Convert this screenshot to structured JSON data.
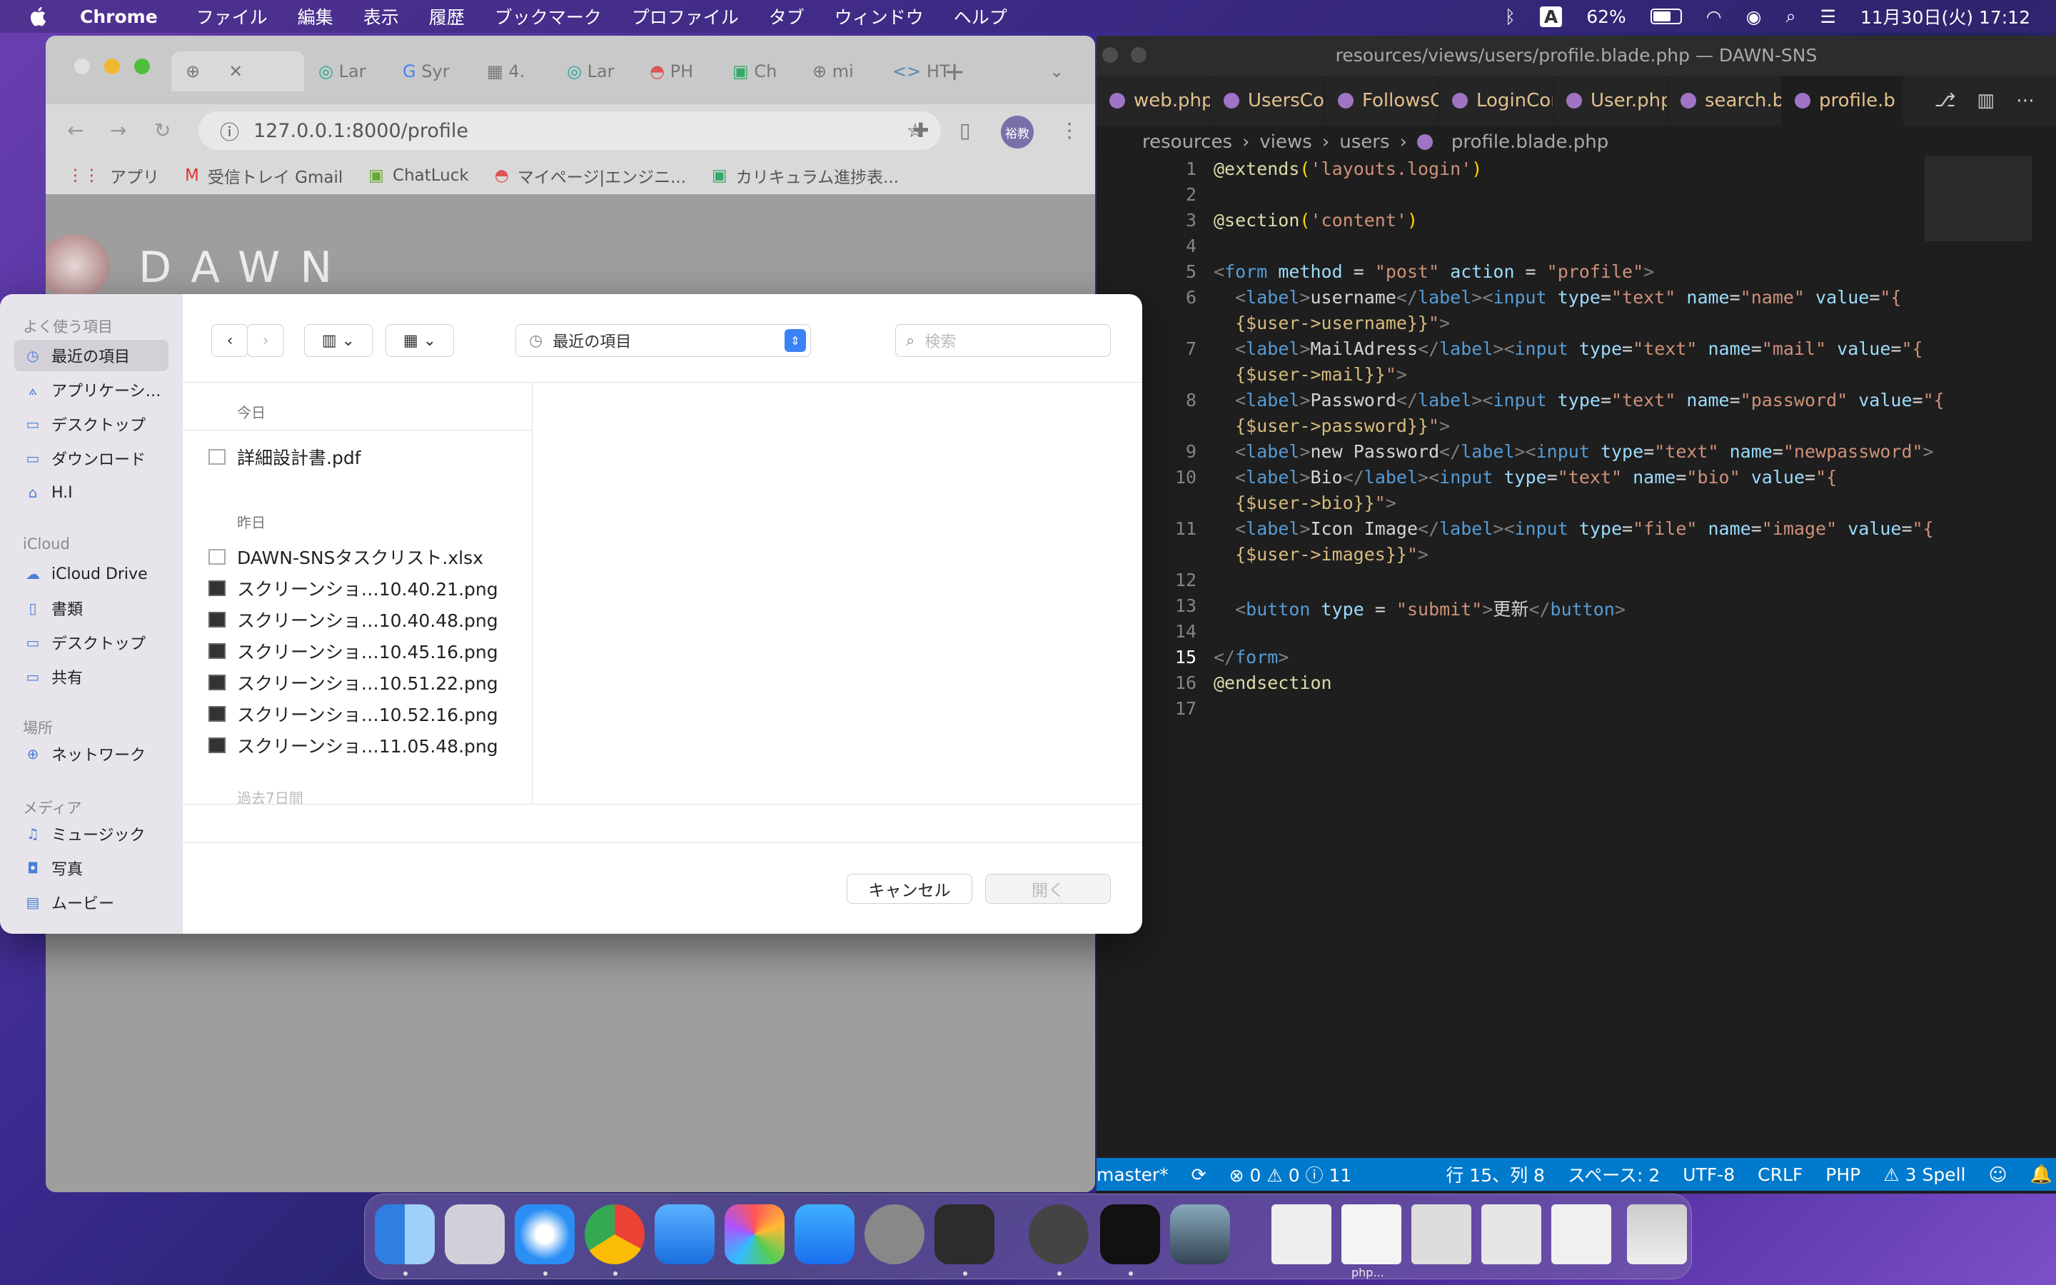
{
  "menubar": {
    "app": "Chrome",
    "items": [
      "ファイル",
      "編集",
      "表示",
      "履歴",
      "ブックマーク",
      "プロファイル",
      "タブ",
      "ウィンドウ",
      "ヘルプ"
    ],
    "input_indicator": "A",
    "battery": "62%",
    "datetime": "11月30日(火)  17:12"
  },
  "vscode": {
    "title": "resources/views/users/profile.blade.php — DAWN-SNS",
    "tabs": [
      "web.php",
      "UsersCo",
      "FollowsC",
      "LoginCon",
      "User.php",
      "search.b",
      "profile.b"
    ],
    "breadcrumb": [
      "resources",
      "views",
      "users",
      "profile.blade.php"
    ],
    "status": {
      "branch": "master*",
      "problems": "⊗ 0 ⚠ 0 ⓘ 11",
      "position": "行 15、列 8",
      "spaces": "スペース: 2",
      "encoding": "UTF-8",
      "eol": "CRLF",
      "language": "PHP",
      "spell": "⚠ 3 Spell"
    },
    "lines": [
      "1",
      "2",
      "3",
      "4",
      "5",
      "6",
      "",
      "7",
      "",
      "8",
      "",
      "9",
      "10",
      "",
      "11",
      "",
      "12",
      "13",
      "14",
      "15",
      "16",
      "17"
    ]
  },
  "chrome": {
    "url": "127.0.0.1:8000/profile",
    "tabs": [
      "Lar",
      "Syr",
      "4.",
      "Lar",
      "PH",
      "Ch",
      "mi",
      "HT"
    ],
    "avatar": "裕教",
    "bookmarks": [
      "アプリ",
      "受信トレイ Gmail",
      "ChatLuck",
      "マイページ|エンジニ...",
      "カリキュラム進捗表..."
    ],
    "page_logo": "DAWN"
  },
  "dialog": {
    "location": "最近の項目",
    "search_placeholder": "検索",
    "sidebar": {
      "favorites_header": "よく使う項目",
      "favorites": [
        "最近の項目",
        "アプリケーシ…",
        "デスクトップ",
        "ダウンロード",
        "H.I"
      ],
      "icloud_header": "iCloud",
      "icloud": [
        "iCloud Drive",
        "書類",
        "デスクトップ",
        "共有"
      ],
      "places_header": "場所",
      "places": [
        "ネットワーク"
      ],
      "media_header": "メディア",
      "media": [
        "ミュージック",
        "写真",
        "ムービー"
      ]
    },
    "groups": {
      "today": "今日",
      "yesterday": "昨日",
      "older": "過去7日間"
    },
    "files_today": [
      "詳細設計書.pdf"
    ],
    "files_yesterday": [
      "DAWN-SNSタスクリスト.xlsx",
      "スクリーンショ…10.40.21.png",
      "スクリーンショ…10.40.48.png",
      "スクリーンショ…10.45.16.png",
      "スクリーンショ…10.51.22.png",
      "スクリーンショ…10.52.16.png",
      "スクリーンショ…11.05.48.png"
    ],
    "cancel": "キャンセル",
    "open": "開く"
  },
  "dock": {
    "php_label": "php..."
  }
}
